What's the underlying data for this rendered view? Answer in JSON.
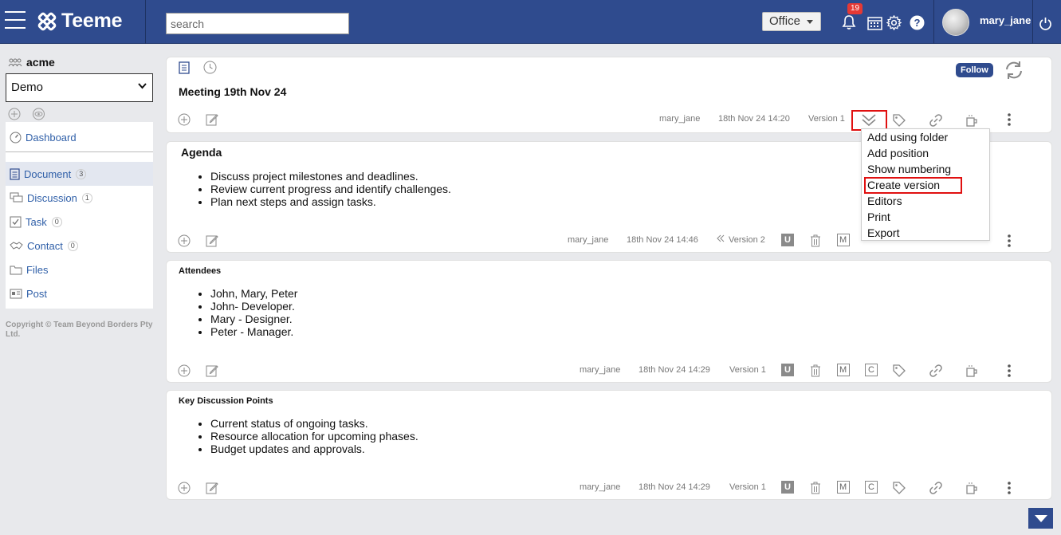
{
  "app": {
    "name": "Teeme"
  },
  "header": {
    "search_placeholder": "search",
    "space_select": "Office",
    "notification_count": "19",
    "username": "mary_jane"
  },
  "sidebar": {
    "org": "acme",
    "workspace": "Demo",
    "items": [
      {
        "label": "Dashboard",
        "count": ""
      },
      {
        "label": "Document",
        "count": "3"
      },
      {
        "label": "Discussion",
        "count": "1"
      },
      {
        "label": "Task",
        "count": "0"
      },
      {
        "label": "Contact",
        "count": "0"
      },
      {
        "label": "Files",
        "count": ""
      },
      {
        "label": "Post",
        "count": ""
      }
    ],
    "copyright": "Copyright © Team Beyond Borders Pty Ltd."
  },
  "document": {
    "title": "Meeting 19th Nov 24",
    "follow_label": "Follow",
    "author": "mary_jane",
    "timestamp": "18th Nov 24 14:20",
    "version": "Version 1"
  },
  "sections": [
    {
      "heading": "Agenda",
      "bullets": [
        "Discuss project milestones and deadlines.",
        "Review current progress and identify challenges.",
        "Plan next steps and assign tasks."
      ],
      "author": "mary_jane",
      "timestamp": "18th Nov 24 14:46",
      "version": "Version 2"
    },
    {
      "heading": "Attendees",
      "bullets": [
        "John, Mary, Peter",
        "John- Developer.",
        "Mary - Designer.",
        "Peter - Manager."
      ],
      "author": "mary_jane",
      "timestamp": "18th Nov 24 14:29",
      "version": "Version 1"
    },
    {
      "heading": "Key Discussion Points",
      "bullets": [
        "Current status of ongoing tasks.",
        "Resource allocation for upcoming phases.",
        "Budget updates and approvals."
      ],
      "author": "mary_jane",
      "timestamp": "18th Nov 24 14:29",
      "version": "Version 1"
    }
  ],
  "badges": {
    "u": "U",
    "m": "M",
    "c": "C"
  },
  "dropdown_menu": [
    "Add using folder",
    "Add position",
    "Show numbering",
    "Create version",
    "Editors",
    "Print",
    "Export"
  ],
  "colors": {
    "header_bg": "#2f4b8e",
    "link": "#2f5fa8",
    "highlight": "#e01010"
  }
}
